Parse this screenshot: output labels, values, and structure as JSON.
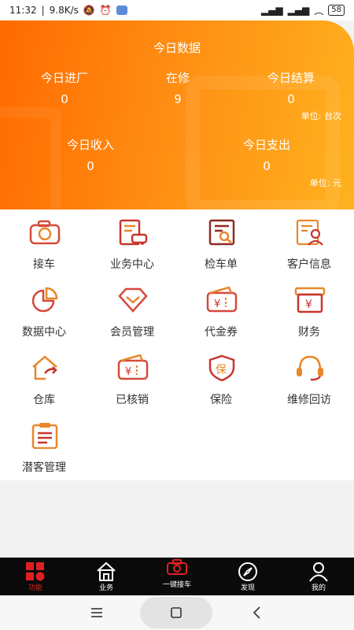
{
  "status_bar": {
    "time": "11:32",
    "speed": "9.8K/s",
    "battery": "58"
  },
  "hero": {
    "title": "今日数据",
    "stats_row1": [
      {
        "label": "今日进厂",
        "value": "0"
      },
      {
        "label": "在修",
        "value": "9"
      },
      {
        "label": "今日结算",
        "value": "0"
      }
    ],
    "unit1": "单位: 台次",
    "stats_row2": [
      {
        "label": "今日收入",
        "value": "0"
      },
      {
        "label": "今日支出",
        "value": "0"
      }
    ],
    "unit2": "单位: 元"
  },
  "grid": {
    "items": [
      {
        "label": "接车",
        "icon": "camera-icon"
      },
      {
        "label": "业务中心",
        "icon": "business-icon"
      },
      {
        "label": "检车单",
        "icon": "inspection-icon"
      },
      {
        "label": "客户信息",
        "icon": "customer-icon"
      },
      {
        "label": "数据中心",
        "icon": "pie-chart-icon"
      },
      {
        "label": "会员管理",
        "icon": "diamond-icon"
      },
      {
        "label": "代金券",
        "icon": "voucher-icon"
      },
      {
        "label": "财务",
        "icon": "finance-icon"
      },
      {
        "label": "仓库",
        "icon": "warehouse-icon"
      },
      {
        "label": "已核销",
        "icon": "verified-voucher-icon"
      },
      {
        "label": "保险",
        "icon": "insurance-icon"
      },
      {
        "label": "维修回访",
        "icon": "headset-icon"
      },
      {
        "label": "潜客管理",
        "icon": "clipboard-icon"
      }
    ]
  },
  "bottom_nav": {
    "items": [
      {
        "label": "功能",
        "icon": "grid-icon",
        "active": true
      },
      {
        "label": "业务",
        "icon": "home-icon"
      },
      {
        "label": "一键接车",
        "icon": "camera-icon"
      },
      {
        "label": "发现",
        "icon": "compass-icon"
      },
      {
        "label": "我的",
        "icon": "user-icon"
      }
    ]
  },
  "colors": {
    "hero_start": "#ff6a00",
    "hero_end": "#ffb21f",
    "icon_red": "#c9352b",
    "icon_orange": "#e8872a",
    "nav_bg": "#0a0a0a",
    "nav_active": "#e02020"
  }
}
